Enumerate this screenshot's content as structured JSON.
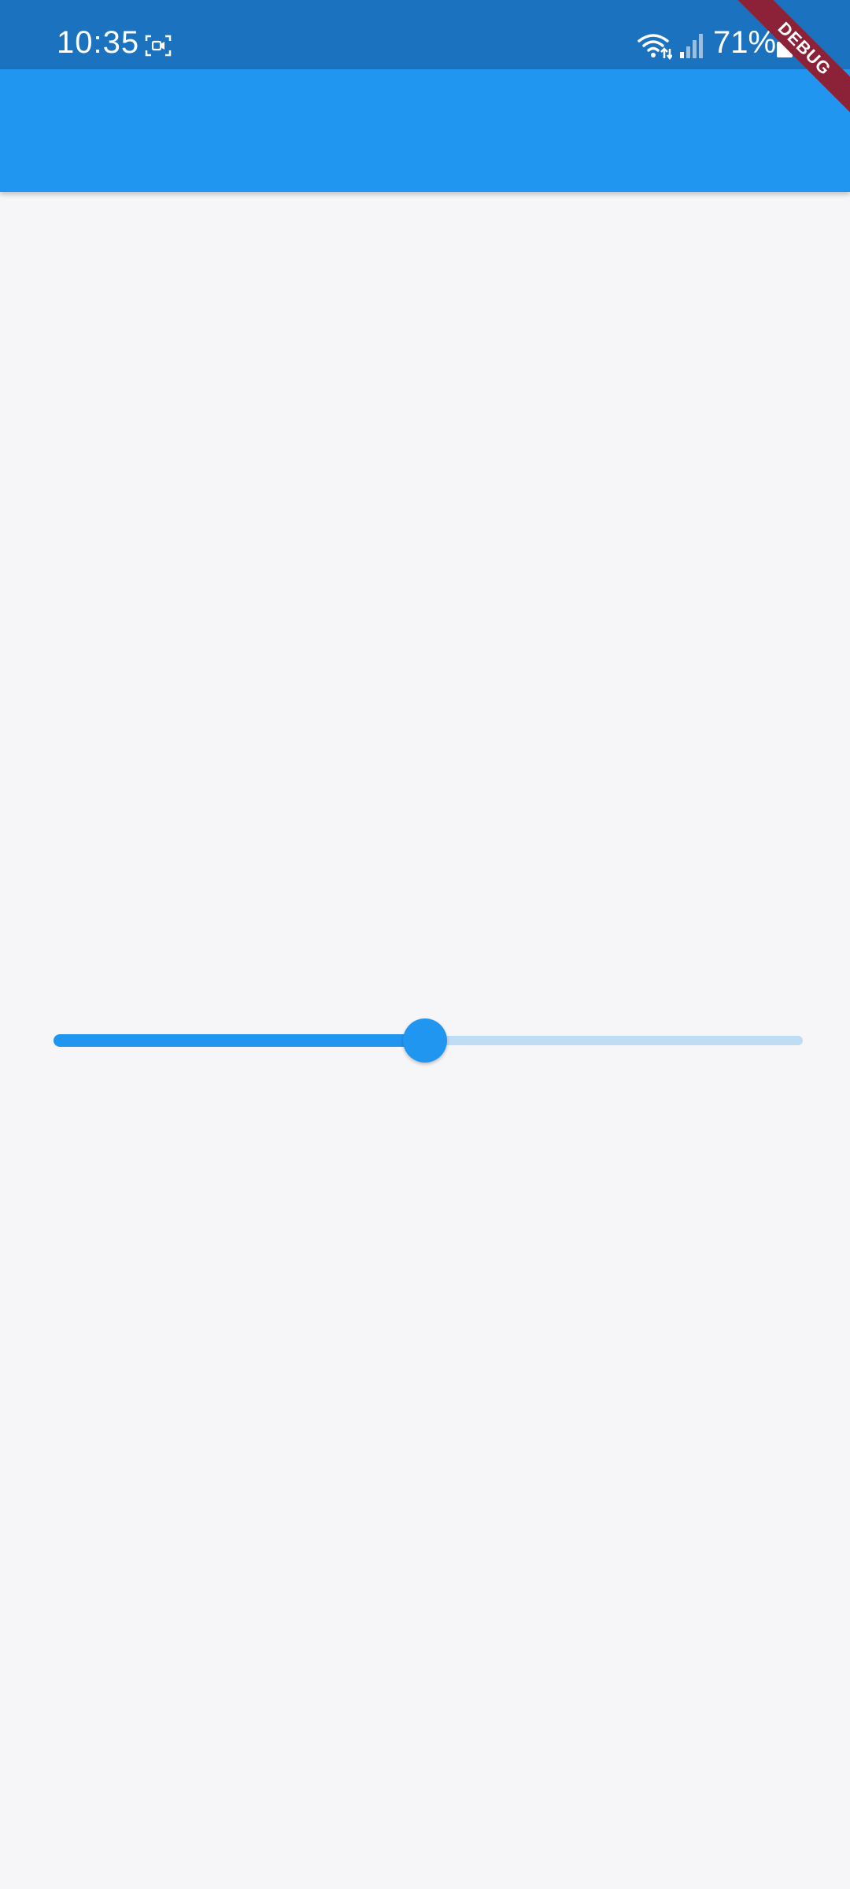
{
  "status_bar": {
    "time": "10:35",
    "battery_percent": "71%",
    "background_color": "#1b73bf",
    "icons": [
      "screen-record-icon",
      "wifi-icon",
      "signal-icon",
      "battery-icon"
    ]
  },
  "app_bar": {
    "title": "",
    "color": "#2196f0"
  },
  "debug_banner": {
    "label": "DEBUG",
    "color": "#8b2238"
  },
  "slider": {
    "value": 0.5,
    "min": 0,
    "max": 1,
    "active_color": "#2196f0",
    "inactive_color": "#bfdcf5"
  }
}
